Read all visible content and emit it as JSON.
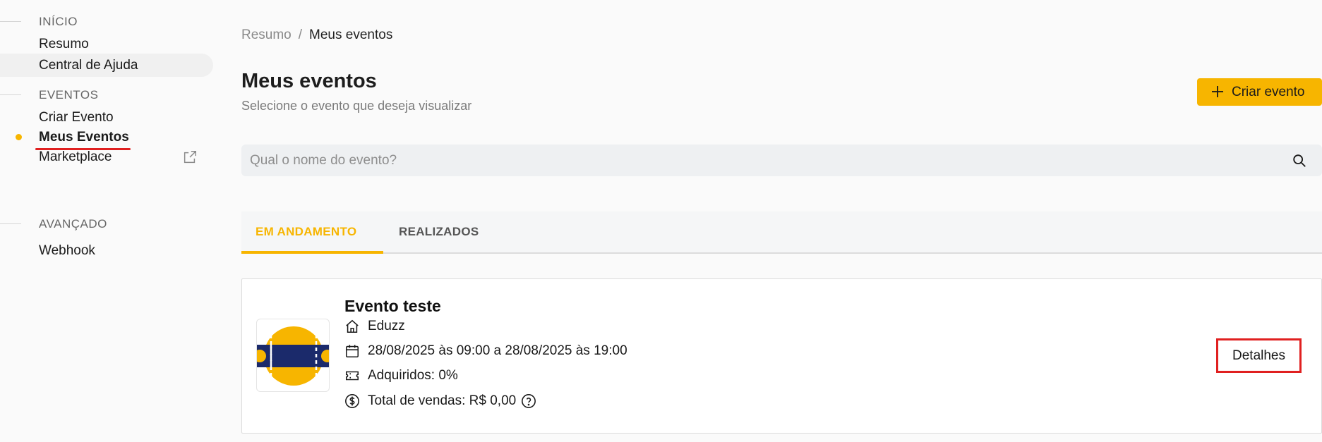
{
  "sidebar": {
    "sections": [
      {
        "title": "INÍCIO",
        "items": [
          {
            "label": "Resumo"
          },
          {
            "label": "Central de Ajuda"
          }
        ]
      },
      {
        "title": "EVENTOS",
        "items": [
          {
            "label": "Criar Evento"
          },
          {
            "label": "Meus Eventos"
          },
          {
            "label": "Marketplace"
          }
        ]
      },
      {
        "title": "AVANÇADO",
        "items": [
          {
            "label": "Webhook"
          }
        ]
      }
    ],
    "active_item": "Meus Eventos"
  },
  "breadcrumb": {
    "parent": "Resumo",
    "separator": "/",
    "current": "Meus eventos"
  },
  "header": {
    "title": "Meus eventos",
    "subtitle": "Selecione o evento que deseja visualizar",
    "create_button": "Criar evento"
  },
  "search": {
    "placeholder": "Qual o nome do evento?",
    "value": ""
  },
  "tabs": [
    {
      "label": "EM ANDAMENTO",
      "active": true
    },
    {
      "label": "REALIZADOS",
      "active": false
    }
  ],
  "event": {
    "name": "Evento teste",
    "organizer": "Eduzz",
    "date": "28/08/2025 às 09:00 a 28/08/2025 às 19:00",
    "acquired": "Adquiridos: 0%",
    "sales": "Total de vendas: R$ 0,00",
    "details_button": "Detalhes"
  },
  "colors": {
    "accent": "#f7b500",
    "highlight": "#e02020",
    "ticket_blue": "#1b2a6b"
  },
  "icons": [
    "external-link-icon",
    "plus-icon",
    "search-icon",
    "home-icon",
    "calendar-icon",
    "ticket-icon",
    "dollar-icon",
    "help-icon"
  ]
}
